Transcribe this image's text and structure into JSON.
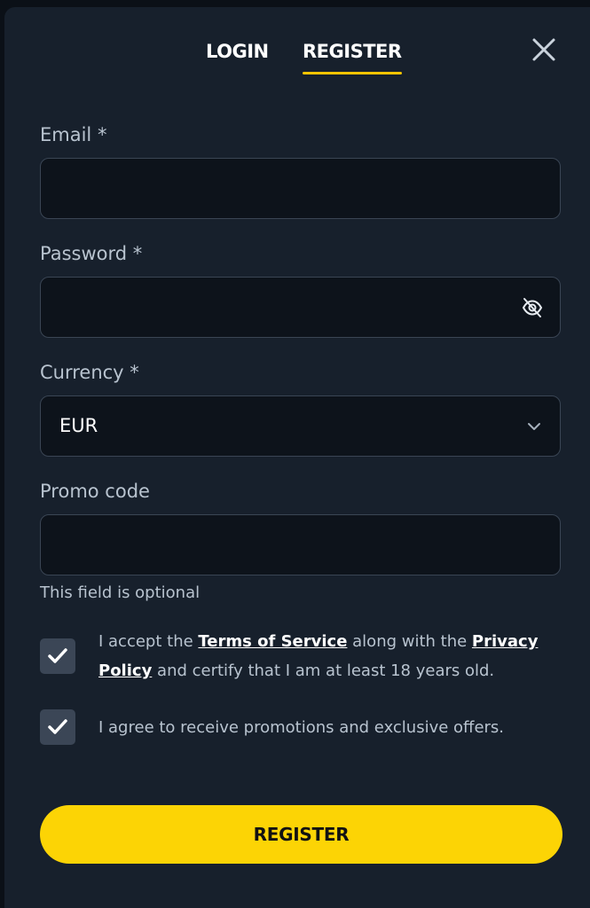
{
  "tabs": {
    "login": "LOGIN",
    "register": "REGISTER",
    "active": "register"
  },
  "icons": {
    "close": "close-icon",
    "password_toggle": "eye-off-icon",
    "currency_dropdown": "chevron-down-icon",
    "checkbox": "checkmark-icon"
  },
  "form": {
    "email": {
      "label": "Email *",
      "value": ""
    },
    "password": {
      "label": "Password *",
      "value": ""
    },
    "currency": {
      "label": "Currency *",
      "value": "EUR"
    },
    "promo": {
      "label": "Promo code",
      "value": "",
      "hint": "This field is optional"
    }
  },
  "consent": {
    "terms": {
      "checked": true,
      "text_before": "I accept the ",
      "terms_link": "Terms of Service",
      "text_middle": " along with the ",
      "privacy_link": "Privacy Policy",
      "text_after": " and certify that I am at least 18 years old."
    },
    "promotions": {
      "checked": true,
      "text": "I agree to receive promotions and exclusive offers."
    }
  },
  "submit": {
    "label": "REGISTER"
  },
  "colors": {
    "accent": "#fcd405",
    "background": "#17202c",
    "input_bg": "#0d131b",
    "checkbox_bg": "#3b4656"
  }
}
